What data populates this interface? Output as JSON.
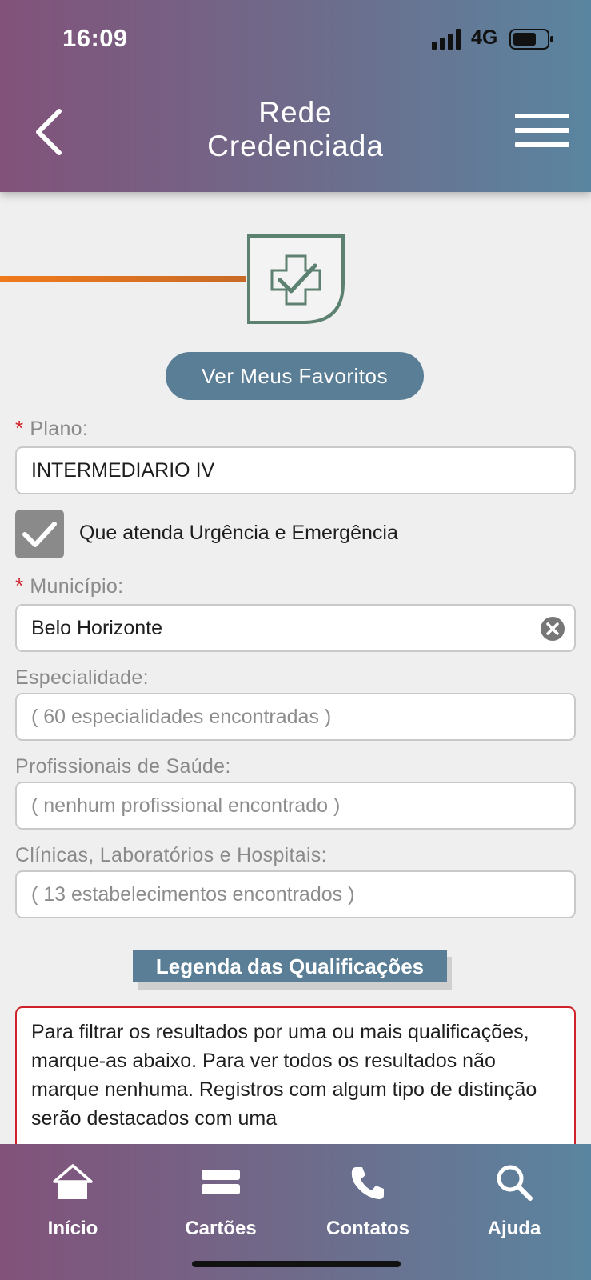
{
  "status_bar": {
    "time": "16:09",
    "network": "4G"
  },
  "header": {
    "title_line1": "Rede",
    "title_line2": "Credenciada"
  },
  "favorites_button": "Ver Meus Favoritos",
  "plano": {
    "label": "Plano:",
    "value": "INTERMEDIARIO IV"
  },
  "urgency_checkbox": {
    "label": "Que atenda Urgência e Emergência",
    "checked": true
  },
  "municipio": {
    "label": "Município:",
    "value": "Belo Horizonte"
  },
  "especialidade": {
    "label": "Especialidade:",
    "value": "( 60 especialidades encontradas )"
  },
  "profissionais": {
    "label": "Profissionais de Saúde:",
    "value": "( nenhum profissional encontrado )"
  },
  "clinicas": {
    "label": "Clínicas, Laboratórios e Hospitais:",
    "value": "( 13 estabelecimentos encontrados )"
  },
  "legend_button": "Legenda das Qualificações",
  "info_text": "Para filtrar os resultados por uma ou mais qualificações, marque-as abaixo. Para ver todos os resultados não marque nenhuma. Registros com algum tipo de distinção serão destacados com uma",
  "nav": [
    {
      "label": "Início",
      "icon": "home-icon"
    },
    {
      "label": "Cartões",
      "icon": "cards-icon"
    },
    {
      "label": "Contatos",
      "icon": "phone-icon"
    },
    {
      "label": "Ajuda",
      "icon": "search-icon"
    }
  ],
  "colors": {
    "header_gradient_start": "#82527a",
    "header_gradient_end": "#5a85a0",
    "primary_button": "#5a7e96",
    "required_marker": "#d0222a",
    "progress_line": "#f07a1c",
    "step_icon": "#5c8170"
  }
}
